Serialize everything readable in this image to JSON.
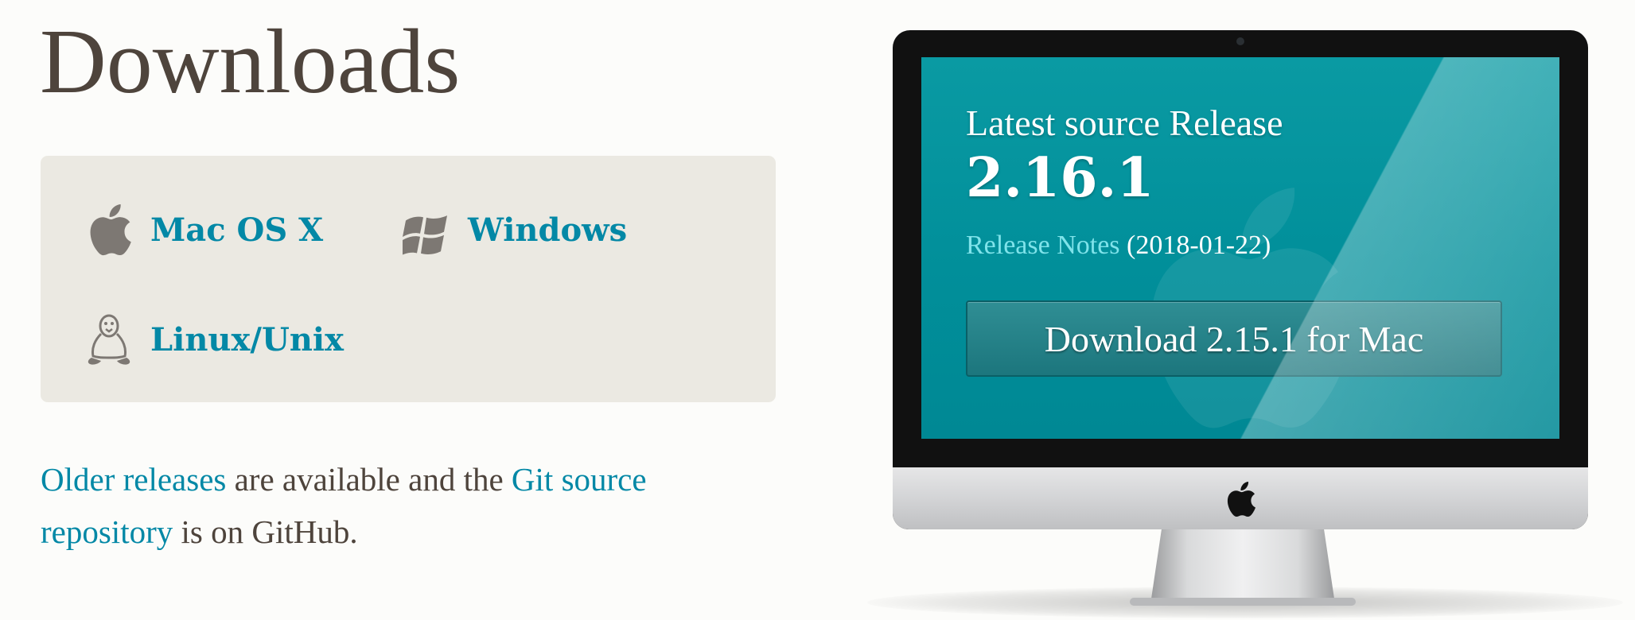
{
  "header": {
    "title": "Downloads"
  },
  "platforms": {
    "mac": {
      "label": "Mac OS X",
      "icon": "apple-icon"
    },
    "windows": {
      "label": "Windows",
      "icon": "windows-icon"
    },
    "linux": {
      "label": "Linux/Unix",
      "icon": "tux-penguin-icon"
    }
  },
  "older": {
    "older_releases_link": "Older releases",
    "middle_text": " are available and the ",
    "git_source_link": "Git source repository",
    "end_text": " is on GitHub."
  },
  "monitor": {
    "heading": "Latest source Release",
    "version": "2.16.1",
    "release_notes_link": "Release Notes",
    "release_date": " (2018-01-22)",
    "download_button": "Download 2.15.1 for Mac"
  },
  "colors": {
    "link": "#0388a6",
    "title": "#4e443c",
    "screen": "#018f9a",
    "box": "#ebe9e2"
  }
}
